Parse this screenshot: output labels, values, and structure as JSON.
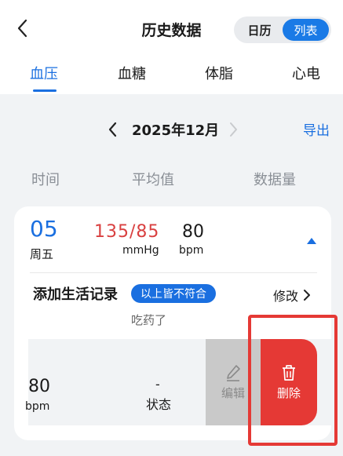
{
  "header": {
    "title": "历史数据",
    "seg": [
      "日历",
      "列表"
    ],
    "seg_active": 1
  },
  "tabs": [
    "血压",
    "血糖",
    "体脂",
    "心电"
  ],
  "month": {
    "label": "2025年12月",
    "export": "导出"
  },
  "columns": [
    "时间",
    "平均值",
    "数据量"
  ],
  "record": {
    "day": "05",
    "weekday": "周五",
    "bp_value": "135/85",
    "bp_unit": "mmHg",
    "hr_value": "80",
    "hr_unit": "bpm",
    "life_title": "添加生活记录",
    "badge": "以上皆不符合",
    "modify": "修改",
    "note": "吃药了"
  },
  "swipe": {
    "hr_value": "80",
    "hr_unit": "bpm",
    "state_dash": "-",
    "state_label": "状态",
    "edit_label": "编辑",
    "delete_label": "删除"
  },
  "colors": {
    "accent": "#1a6fe0",
    "bp_red": "#d94040",
    "delete_red": "#e53935"
  }
}
